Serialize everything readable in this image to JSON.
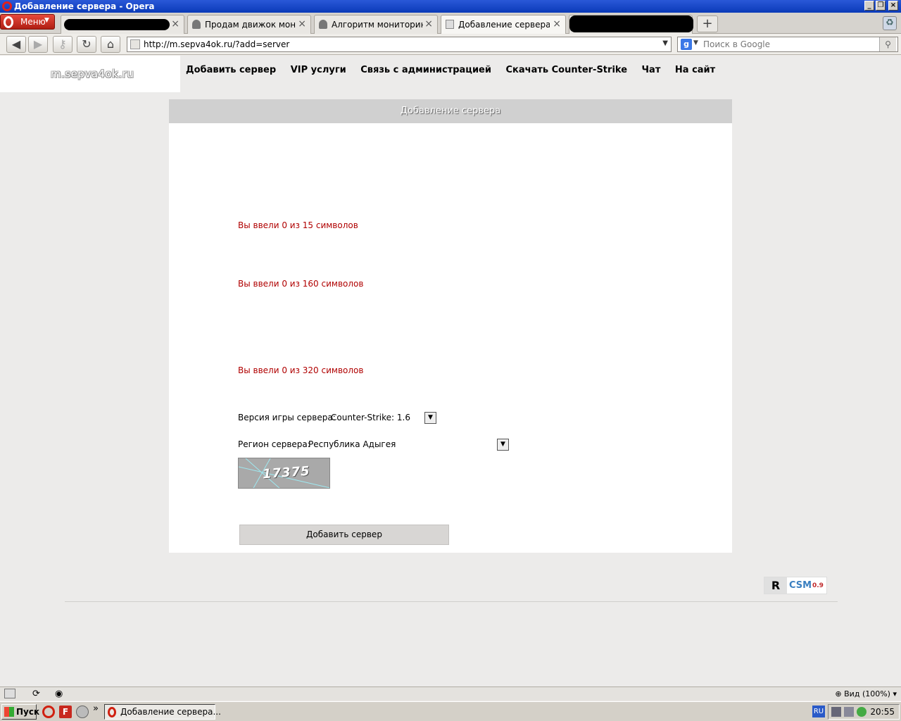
{
  "window": {
    "title": "Добавление сервера - Opera"
  },
  "tabs": {
    "menu_label": "Меню",
    "items": [
      {
        "label": ""
      },
      {
        "label": "Продам движок монито…"
      },
      {
        "label": "Алгоритм мониторинга …"
      },
      {
        "label": "Добавление сервера"
      },
      {
        "label": ""
      }
    ]
  },
  "address": {
    "url": "http://m.sepva4ok.ru/?add=server",
    "search_placeholder": "Поиск в Google"
  },
  "site": {
    "logo": "m.sepva4ok.ru",
    "nav": [
      "Добавить сервер",
      "VIP услуги",
      "Связь с администрацией",
      "Скачать Counter-Strike",
      "Чат",
      "На сайт"
    ]
  },
  "form": {
    "header": "Добавление сервера",
    "counters": [
      "Вы ввели 0 из 15 символов",
      "Вы ввели 0 из 160 символов",
      "Вы ввели 0 из 320 символов"
    ],
    "version_label": "Версия игры сервера:",
    "version_value": "Counter-Strike: 1.6",
    "region_label": "Регион сервера:",
    "region_value": "Республика Адыгея",
    "captcha_text": "17375",
    "submit_label": "Добавить сервер"
  },
  "footer": {
    "badge_letter": "R",
    "badge_name": "CSM",
    "badge_version": "0.9"
  },
  "statusbar": {
    "zoom": "Вид (100%)"
  },
  "taskbar": {
    "start_label": "Пуск",
    "task_label": "Добавление сервера...",
    "lang": "RU",
    "clock": "20:55"
  }
}
